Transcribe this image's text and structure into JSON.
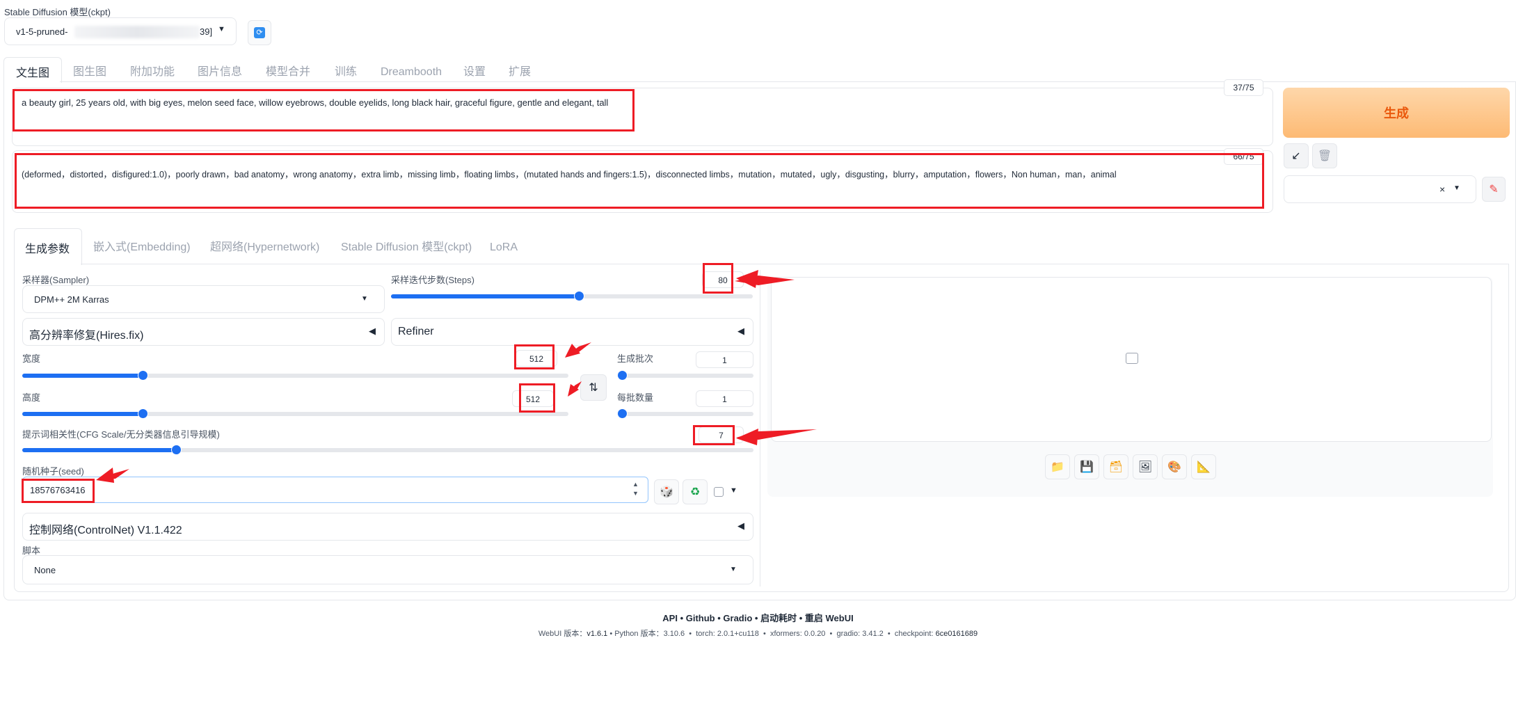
{
  "checkpoint": {
    "label": "Stable Diffusion 模型(ckpt)",
    "value_prefix": "v1-5-pruned-",
    "value_suffix": "39]"
  },
  "top_tabs": [
    "文生图",
    "图生图",
    "附加功能",
    "图片信息",
    "模型合并",
    "训练",
    "Dreambooth",
    "设置",
    "扩展"
  ],
  "prompt": {
    "text": "a beauty girl, 25 years old, with big eyes, melon seed face, willow eyebrows, double eyelids, long black hair, graceful figure, gentle and elegant, tall",
    "token_count": "37/75"
  },
  "negative_prompt": {
    "text": "(deformed，distorted，disfigured:1.0)，poorly drawn，bad anatomy，wrong anatomy，extra limb，missing limb，floating limbs，(mutated hands and fingers:1.5)，disconnected limbs，mutation，mutated，ugly，disgusting，blurry，amputation，flowers，Non human，man，animal",
    "token_count": "66/75"
  },
  "generate_label": "生成",
  "sub_tabs": [
    "生成参数",
    "嵌入式(Embedding)",
    "超网络(Hypernetwork)",
    "Stable Diffusion 模型(ckpt)",
    "LoRA"
  ],
  "sampler": {
    "label": "采样器(Sampler)",
    "value": "DPM++ 2M Karras"
  },
  "steps": {
    "label": "采样迭代步数(Steps)",
    "value": "80",
    "fraction": 0.52
  },
  "hires_label": "高分辨率修复(Hires.fix)",
  "refiner_label": "Refiner",
  "width": {
    "label": "宽度",
    "value": "512",
    "fraction": 0.22
  },
  "height": {
    "label": "高度",
    "value": "512",
    "fraction": 0.22
  },
  "batch_count": {
    "label": "生成批次",
    "value": "1",
    "fraction": 0.0
  },
  "batch_size": {
    "label": "每批数量",
    "value": "1",
    "fraction": 0.0
  },
  "cfg": {
    "label": "提示词相关性(CFG Scale/无分类器信息引导规模)",
    "value": "7",
    "fraction": 0.21
  },
  "seed": {
    "label": "随机种子(seed)",
    "value": "18576763416"
  },
  "controlnet_label": "控制网络(ControlNet) V1.1.422",
  "script": {
    "label": "脚本",
    "value": "None"
  },
  "footer": {
    "links": [
      "API",
      "Github",
      "Gradio",
      "启动耗时",
      "重启 WebUI"
    ],
    "webui_label": "WebUI 版本：",
    "webui_version": "v1.6.1",
    "python_label": "Python 版本：",
    "python_version": "3.10.6",
    "torch": "torch: 2.0.1+cu118",
    "xformers": "xformers: 0.0.20",
    "gradio": "gradio: 3.41.2",
    "checkpoint_label": "checkpoint: ",
    "checkpoint_hash": "6ce0161689"
  },
  "colors": {
    "accent": "#1d6ff2",
    "generate_bg": "#fdba74",
    "generate_text": "#ea580c",
    "annotation": "#ee1c25"
  },
  "icons": [
    "refresh-icon",
    "dropdown-arrow-icon",
    "paste-icon",
    "trash-icon",
    "clear-icon",
    "paint-brush-icon",
    "swap-icon",
    "dice-icon",
    "recycle-icon",
    "folder-icon",
    "save-icon",
    "zip-icon",
    "image-icon",
    "palette-icon",
    "ruler-icon",
    "image-placeholder-icon"
  ]
}
